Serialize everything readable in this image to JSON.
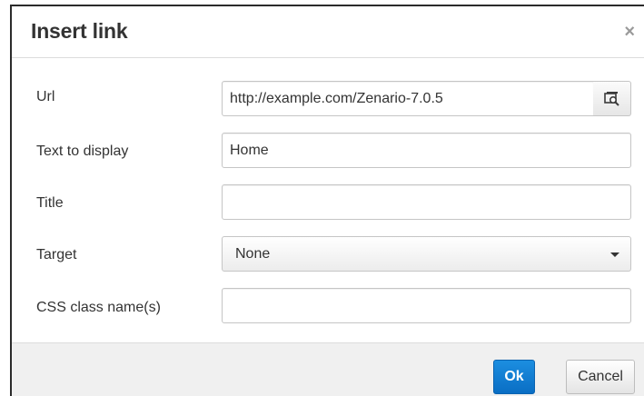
{
  "dialog": {
    "title": "Insert link",
    "close_glyph": "×"
  },
  "form": {
    "url_label": "Url",
    "url_value": "http://example.com/Zenario-7.0.5",
    "browse_icon": "browse-image-icon",
    "text_label": "Text to display",
    "text_value": "Home",
    "title_label": "Title",
    "title_value": "",
    "target_label": "Target",
    "target_value": "None",
    "css_label": "CSS class name(s)",
    "css_value": ""
  },
  "footer": {
    "ok_label": "Ok",
    "cancel_label": "Cancel"
  },
  "colors": {
    "primary_button": "#0a6ec4",
    "border": "#c5c5c5",
    "footer_bg": "#f0f0f0"
  }
}
